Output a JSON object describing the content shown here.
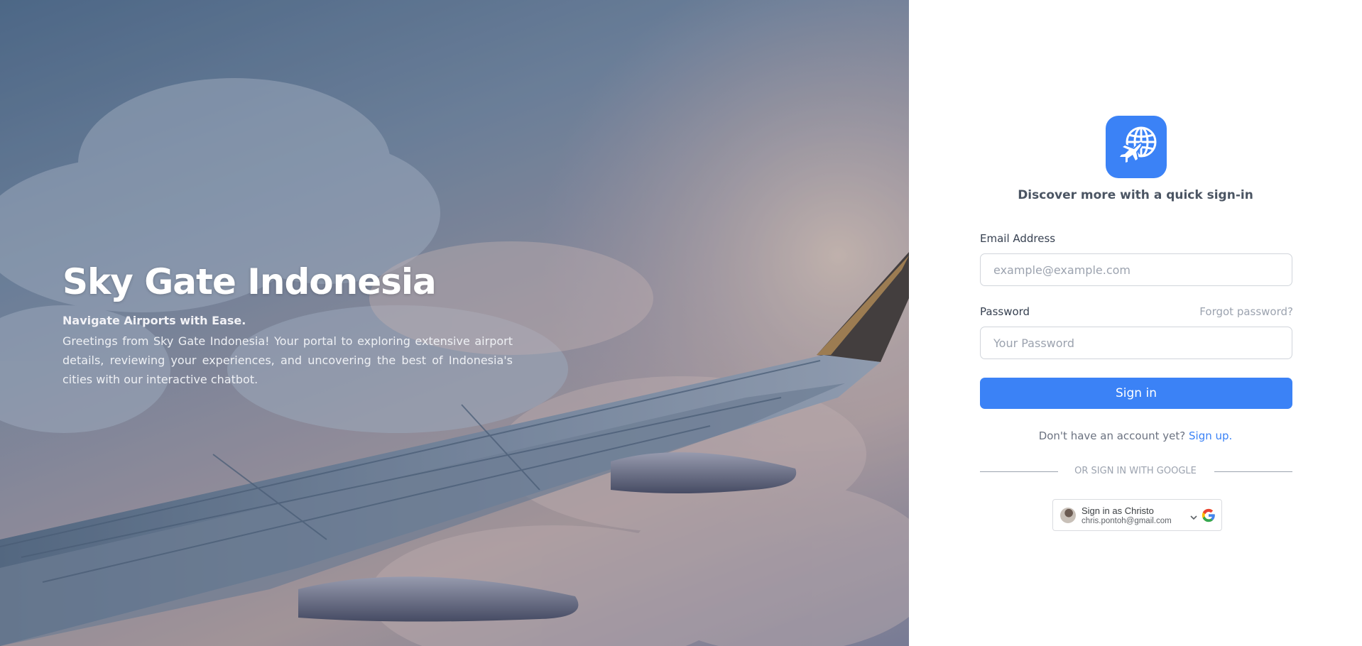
{
  "hero": {
    "title": "Sky Gate Indonesia",
    "subtitle": "Navigate Airports with Ease.",
    "description": "Greetings from Sky Gate Indonesia! Your portal to exploring extensive airport details, reviewing your experiences, and uncovering the best of Indonesia's cities with our interactive chatbot."
  },
  "auth": {
    "logo_icon": "globe-airplane-icon",
    "tagline": "Discover more with a quick sign-in",
    "email": {
      "label": "Email Address",
      "placeholder": "example@example.com",
      "value": ""
    },
    "password": {
      "label": "Password",
      "placeholder": "Your Password",
      "value": ""
    },
    "forgot_label": "Forgot password?",
    "signin_label": "Sign in",
    "signup_prompt": "Don't have an account yet?",
    "signup_link": "Sign up.",
    "divider": "OR SIGN IN WITH GOOGLE",
    "google": {
      "name_label": "Sign in as Christo",
      "email": "chris.pontoh@gmail.com"
    }
  },
  "colors": {
    "accent": "#3b82f6",
    "text_muted": "#9ca3af"
  }
}
